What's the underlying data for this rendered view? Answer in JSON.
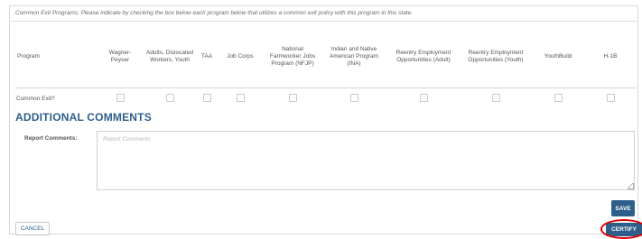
{
  "instructions": "Common Exit Programs: Please indicate by checking the box below each program below that utilizes a common exit policy with this program in this state.",
  "table": {
    "program_header": "Program",
    "columns": [
      "Wagner-Peyser",
      "Adults, Dislocated Workers, Youth",
      "TAA",
      "Job Corps",
      "National Farmworker Jobs Program (NFJP)",
      "Indian and Native American Program (INA)",
      "Reentry Employment Opportunities (Adult)",
      "Reentry Employment Opportunities (Youth)",
      "YouthBuild",
      "H-1B"
    ],
    "row_label": "Common Exit?",
    "checked": [
      false,
      false,
      false,
      false,
      false,
      false,
      false,
      false,
      false,
      false
    ]
  },
  "additional_comments": {
    "title": "ADDITIONAL COMMENTS",
    "report_label": "Report Comments:",
    "placeholder": "Report Comments",
    "value": ""
  },
  "buttons": {
    "save": "SAVE",
    "cancel": "CANCEL",
    "certify": "CERTIFY"
  },
  "colors": {
    "accent": "#2e5f8a",
    "highlight_ring": "#e00000"
  }
}
